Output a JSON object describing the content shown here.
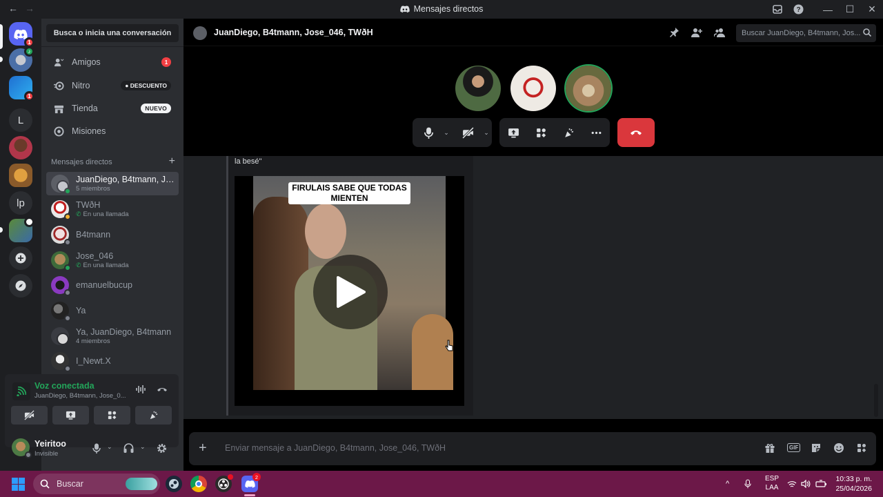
{
  "window": {
    "title": "Mensajes directos"
  },
  "sidebar": {
    "search_label": "Busca o inicia una conversación",
    "nav": [
      {
        "label": "Amigos",
        "count": "1"
      },
      {
        "label": "Nitro",
        "badge": "DESCUENTO"
      },
      {
        "label": "Tienda",
        "badge": "NUEVO"
      },
      {
        "label": "Misiones"
      }
    ],
    "dm_header": "Mensajes directos",
    "dms": [
      {
        "name": "JuanDiego, B4tmann, Jose_046, TWðH",
        "sub": "5 miembros"
      },
      {
        "name": "TWðH",
        "sub": "En una llamada"
      },
      {
        "name": "B4tmann"
      },
      {
        "name": "Jose_046",
        "sub": "En una llamada"
      },
      {
        "name": "emanuelbucup"
      },
      {
        "name": "Ya"
      },
      {
        "name": "Ya, JuanDiego, B4tmann",
        "sub": "4 miembros"
      },
      {
        "name": "I_Newt.X"
      }
    ],
    "servers": [
      {
        "label": "L"
      },
      {
        "label": "lp"
      }
    ],
    "server_badges": [
      "1",
      "1",
      "1"
    ]
  },
  "voice": {
    "title": "Voz conectada",
    "channel": "JuanDiego, B4tmann, Jose_0..."
  },
  "user": {
    "name": "Yeiritoo",
    "status": "Invisible"
  },
  "header": {
    "title": "JuanDiego, B4tmann, Jose_046, TWðH",
    "search_placeholder": "Buscar JuanDiego, B4tmann, Jos..."
  },
  "message": {
    "quote_text": "la besé\"",
    "video_caption": "FIRULAIS SABE QUE TODAS MIENTEN"
  },
  "composer": {
    "placeholder": "Enviar mensaje a JuanDiego, B4tmann, Jose_046, TWðH",
    "gif_label": "GIF"
  },
  "taskbar": {
    "search_label": "Buscar",
    "discord_badge": "2",
    "lang_top": "ESP",
    "lang_bottom": "LAA",
    "time": "10:33 p. m.",
    "date": "25/04/2026"
  },
  "colors": {
    "accent": "#5865f2",
    "online": "#23a55a",
    "danger": "#da373c",
    "taskbar": "#6c1848"
  }
}
